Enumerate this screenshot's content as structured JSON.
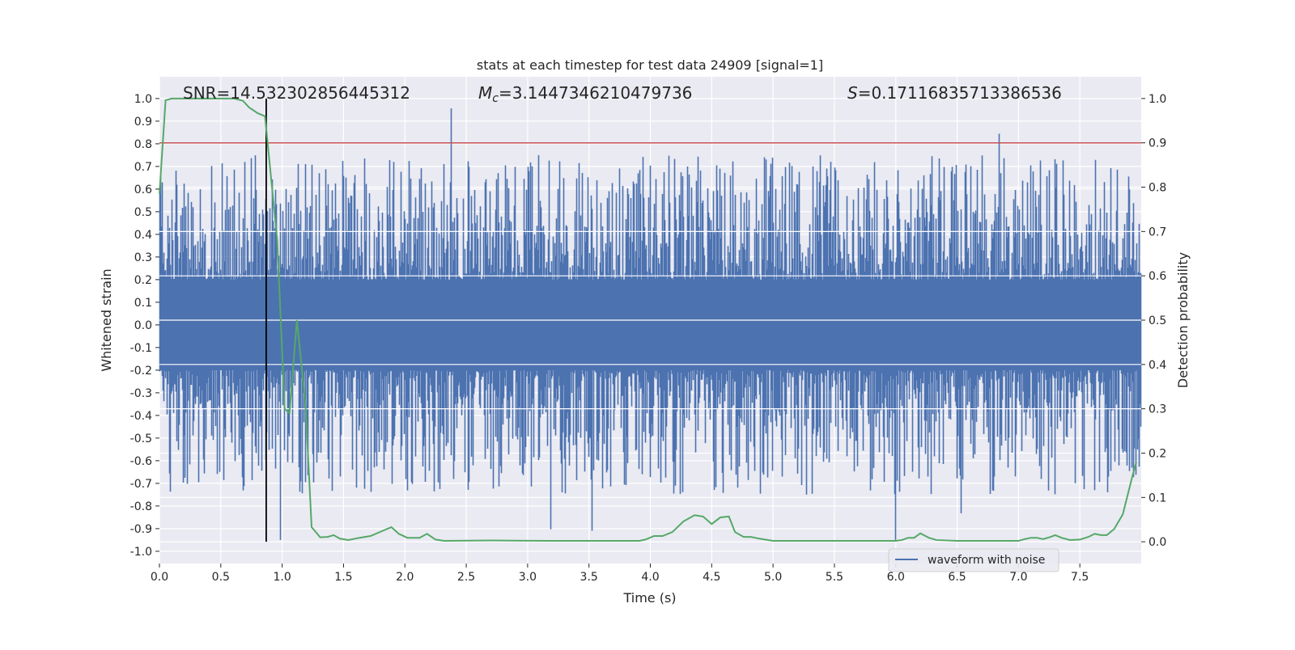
{
  "chart_data": {
    "type": "line",
    "title": "stats at each timestep for test data 24909 [signal=1]",
    "xlabel": "Time (s)",
    "ylabel_left": "Whitened strain",
    "ylabel_right": "Detection probability",
    "xlim": [
      0,
      8
    ],
    "ylim_left": [
      -1.054,
      1.096
    ],
    "ylim_right": [
      -0.049,
      1.049
    ],
    "grid": true,
    "legend_placement": "lower-center-right",
    "x_ticks": [
      "0.0",
      "0.5",
      "1.0",
      "1.5",
      "2.0",
      "2.5",
      "3.0",
      "3.5",
      "4.0",
      "4.5",
      "5.0",
      "5.5",
      "6.0",
      "6.5",
      "7.0",
      "7.5"
    ],
    "y_ticks_left": [
      "-1.0",
      "-0.9",
      "-0.8",
      "-0.7",
      "-0.6",
      "-0.5",
      "-0.4",
      "-0.3",
      "-0.2",
      "-0.1",
      "0.0",
      "0.1",
      "0.2",
      "0.3",
      "0.4",
      "0.5",
      "0.6",
      "0.7",
      "0.8",
      "0.9",
      "1.0"
    ],
    "y_ticks_right": [
      "0.0",
      "0.1",
      "0.2",
      "0.3",
      "0.4",
      "0.5",
      "0.6",
      "0.7",
      "0.8",
      "0.9",
      "1.0"
    ],
    "annotations": {
      "snr": "SNR=14.532302856445312",
      "mc_symbol": "M",
      "mc_sub": "c",
      "mc_value": "=3.1447346210479736",
      "s_symbol": "S",
      "s_value": "=0.17116835713386536"
    },
    "series": [
      {
        "name": "waveform with noise",
        "axis": "left",
        "color": "#4c72b0",
        "kind": "noise band",
        "core_amplitude": 0.2,
        "peak_range": [
          -0.95,
          1.0
        ]
      },
      {
        "axis": "right",
        "color": "#55a868",
        "x": [
          0,
          0.05,
          0.1,
          0.61,
          0.68,
          0.73,
          0.8,
          0.86,
          0.96,
          1.02,
          1.06,
          1.12,
          1.19,
          1.24,
          1.31,
          1.37,
          1.42,
          1.47,
          1.54,
          1.63,
          1.72,
          1.83,
          1.89,
          1.95,
          2.02,
          2.12,
          2.18,
          2.25,
          2.32,
          2.7,
          3.2,
          3.91,
          3.96,
          4.03,
          4.1,
          4.18,
          4.27,
          4.36,
          4.43,
          4.5,
          4.57,
          4.64,
          4.69,
          4.76,
          4.82,
          4.89,
          5.0,
          6.0,
          6.05,
          6.1,
          6.15,
          6.2,
          6.27,
          6.33,
          6.5,
          7.0,
          7.05,
          7.1,
          7.15,
          7.2,
          7.25,
          7.3,
          7.35,
          7.42,
          7.5,
          7.57,
          7.62,
          7.67,
          7.72,
          7.78,
          7.85,
          7.93,
          7.96
        ],
        "y": [
          0.785,
          0.996,
          1.0,
          1.0,
          0.995,
          0.98,
          0.967,
          0.96,
          0.68,
          0.3,
          0.29,
          0.5,
          0.31,
          0.033,
          0.01,
          0.011,
          0.015,
          0.007,
          0.004,
          0.009,
          0.013,
          0.026,
          0.033,
          0.018,
          0.009,
          0.009,
          0.018,
          0.005,
          0.002,
          0.003,
          0.002,
          0.002,
          0.005,
          0.013,
          0.013,
          0.022,
          0.046,
          0.06,
          0.057,
          0.04,
          0.055,
          0.057,
          0.022,
          0.011,
          0.011,
          0.007,
          0.002,
          0.002,
          0.004,
          0.009,
          0.009,
          0.019,
          0.009,
          0.004,
          0.002,
          0.002,
          0.006,
          0.009,
          0.009,
          0.006,
          0.01,
          0.015,
          0.009,
          0.004,
          0.005,
          0.011,
          0.018,
          0.015,
          0.015,
          0.029,
          0.062,
          0.15,
          0.18
        ]
      },
      {
        "axis": "right",
        "color": "#c44e52",
        "kind": "horizontal threshold",
        "y": 0.9
      },
      {
        "axis": "right",
        "color": "#000000",
        "kind": "vertical marker",
        "x": 0.87,
        "y_range": [
          0,
          1
        ]
      }
    ],
    "colors": {
      "background": "#eaeaf2",
      "grid": "#ffffff"
    }
  }
}
